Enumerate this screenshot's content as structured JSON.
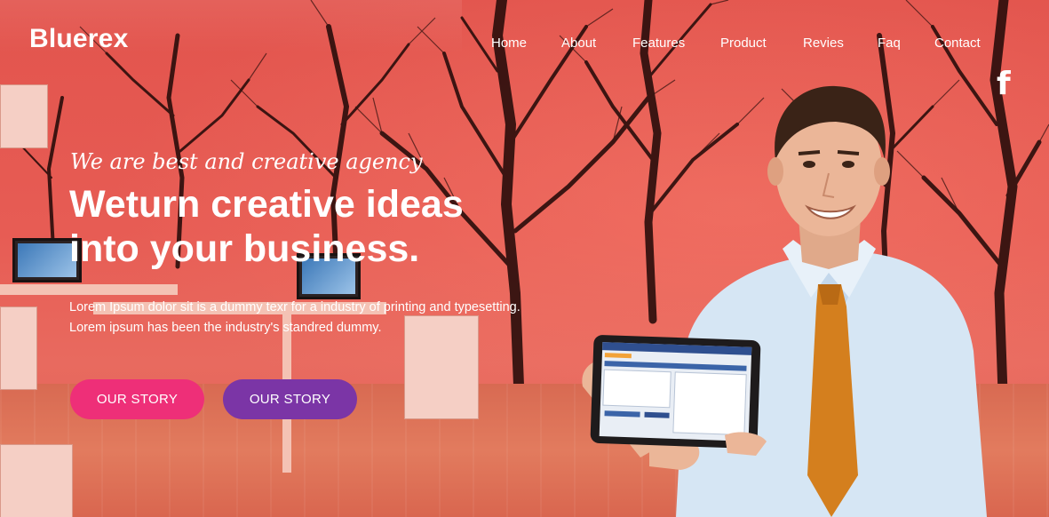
{
  "brand": {
    "logo_text": "Bluerex"
  },
  "nav": {
    "items": [
      {
        "label": "Home"
      },
      {
        "label": "About"
      },
      {
        "label": "Features"
      },
      {
        "label": "Product"
      },
      {
        "label": "Revies"
      },
      {
        "label": "Faq"
      },
      {
        "label": "Contact"
      }
    ]
  },
  "social": {
    "facebook_icon": "facebook-icon"
  },
  "hero": {
    "tagline": "We are best and creative agency",
    "headline_line1": "Weturn creative ideas",
    "headline_line2": "into your business.",
    "desc_line1": "Lorem Ipsum dolor sit is a dummy texr for a industry of printing and typesetting.",
    "desc_line2": "Lorem ipsum has been the industry's standred dummy.",
    "button_primary": "OUR STORY",
    "button_secondary": "OUR STORY"
  },
  "colors": {
    "overlay": "#e85d55",
    "button_primary": "#ee2f78",
    "button_secondary": "#7b35a6",
    "tie": "#d47f1e",
    "shirt": "#d6e6f4"
  }
}
